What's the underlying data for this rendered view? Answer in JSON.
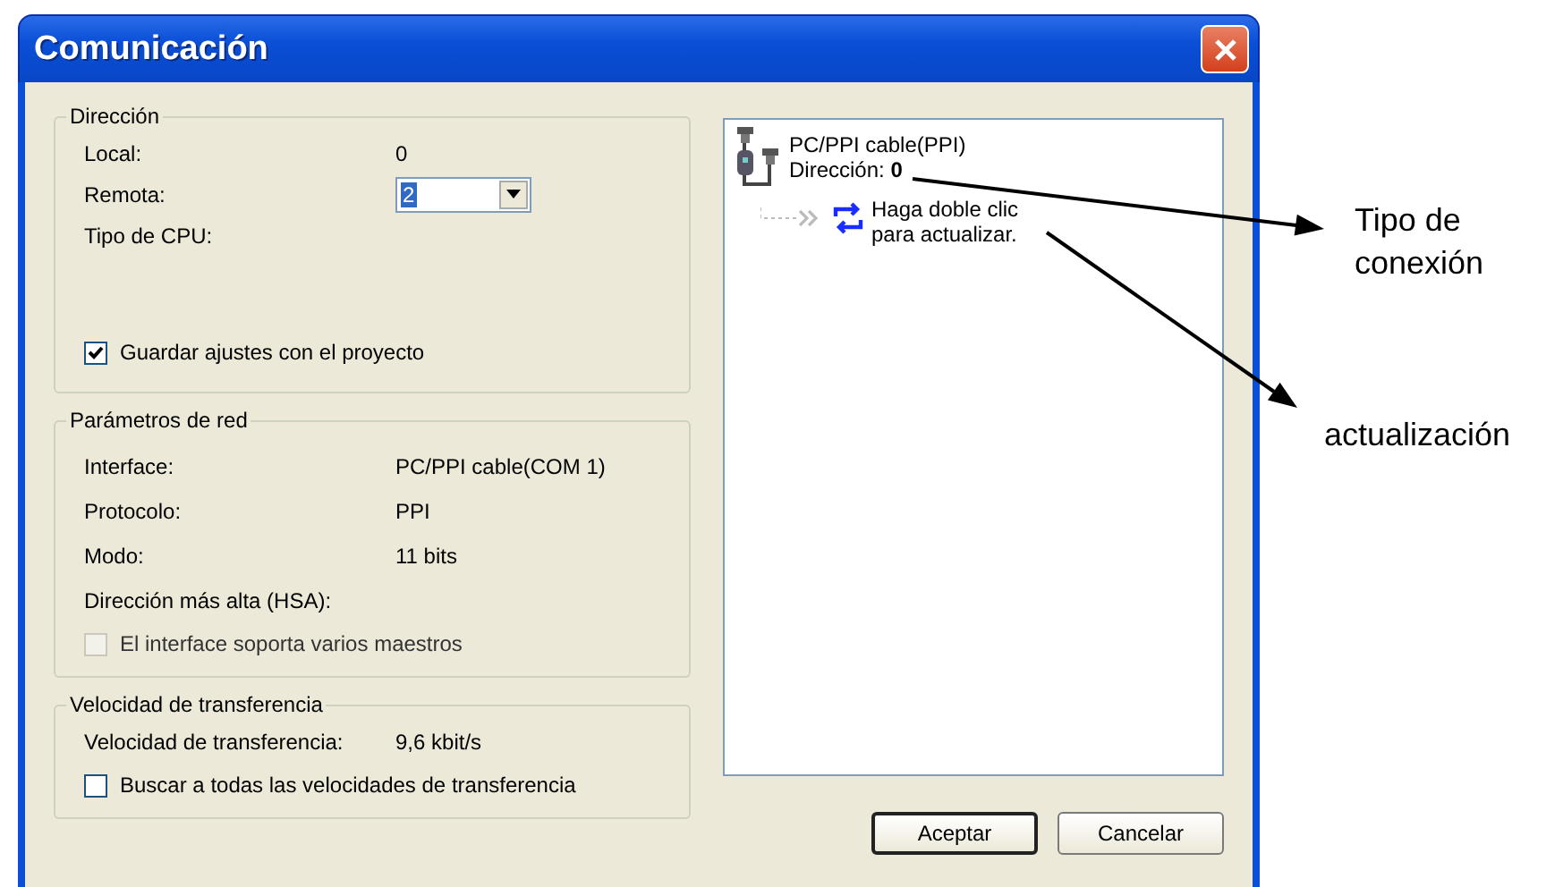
{
  "window": {
    "title": "Comunicación"
  },
  "address_group": {
    "title": "Dirección",
    "local": {
      "label": "Local:",
      "value": "0"
    },
    "remote": {
      "label": "Remota:",
      "value": "2"
    },
    "cpu_type": {
      "label": "Tipo de CPU:"
    },
    "save_settings": {
      "label": "Guardar ajustes con el proyecto",
      "checked": true,
      "disabled": false
    }
  },
  "network_group": {
    "title": "Parámetros de red",
    "rows": [
      {
        "label": "Interface:",
        "value": "PC/PPI cable(COM 1)"
      },
      {
        "label": "Protocolo:",
        "value": "PPI"
      },
      {
        "label": "Modo:",
        "value": "11 bits"
      },
      {
        "label": "Dirección más alta (HSA):"
      }
    ],
    "multi_master": {
      "label": "El interface soporta varios maestros",
      "checked": false,
      "disabled": true
    }
  },
  "speed_group": {
    "title": "Velocidad de transferencia",
    "rate": {
      "label": "Velocidad de transferencia:",
      "value": "9,6 kbit/s"
    },
    "search_all": {
      "label": "Buscar a todas las velocidades de transferencia",
      "checked": false,
      "disabled": false
    }
  },
  "tree": {
    "cable": {
      "name": "PC/PPI cable(PPI)",
      "address": "Dirección: **0**"
    },
    "refresh": {
      "lines": [
        "Haga doble clic",
        "para actualizar."
      ]
    }
  },
  "buttons": [
    {
      "label": "Aceptar",
      "default": true
    },
    {
      "label": "Cancelar",
      "default": false
    }
  ],
  "annotations": [
    {
      "lines": [
        "Tipo de",
        "conexión"
      ]
    },
    {
      "lines": [
        "actualización"
      ]
    }
  ]
}
